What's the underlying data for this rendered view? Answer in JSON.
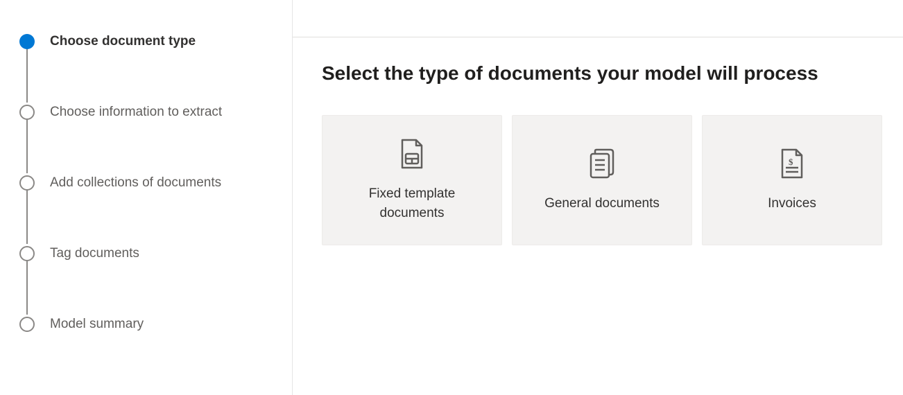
{
  "sidebar": {
    "steps": [
      {
        "label": "Choose document type",
        "state": "active"
      },
      {
        "label": "Choose information to extract",
        "state": "pending"
      },
      {
        "label": "Add collections of documents",
        "state": "pending"
      },
      {
        "label": "Tag documents",
        "state": "pending"
      },
      {
        "label": "Model summary",
        "state": "pending"
      }
    ]
  },
  "main": {
    "title": "Select the type of documents your model will process",
    "cards": [
      {
        "label": "Fixed template documents",
        "icon": "document-template-icon"
      },
      {
        "label": "General documents",
        "icon": "document-general-icon"
      },
      {
        "label": "Invoices",
        "icon": "document-invoice-icon"
      }
    ]
  }
}
